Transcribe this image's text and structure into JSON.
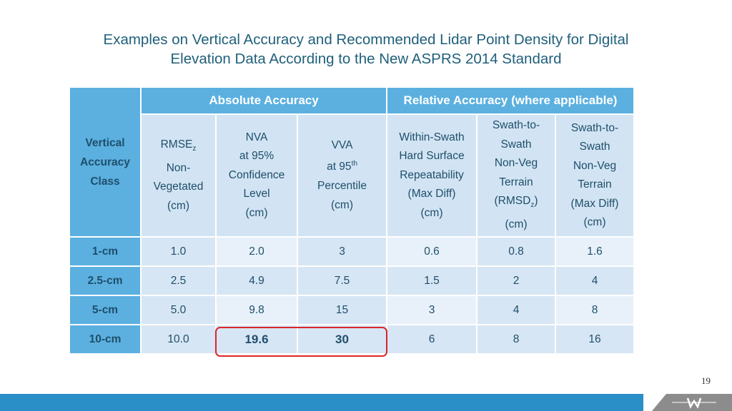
{
  "title": {
    "line1": "Examples on Vertical Accuracy and Recommended Lidar Point Density for Digital",
    "line2": "Elevation Data According to the New ASPRS 2014 Standard"
  },
  "table": {
    "group_headers": {
      "row_label": [
        "Vertical",
        "Accuracy",
        "Class"
      ],
      "absolute": "Absolute Accuracy",
      "relative": "Relative Accuracy (where applicable)"
    },
    "columns": [
      {
        "lines": [
          "RMSE",
          "Non-",
          "Vegetated",
          "(cm)"
        ],
        "first_sub": "z"
      },
      {
        "lines": [
          "NVA",
          "at 95%",
          "Confidence",
          "Level",
          "(cm)"
        ]
      },
      {
        "lines": [
          "VVA",
          "at 95",
          "Percentile",
          "(cm)"
        ],
        "second_sup": "th"
      },
      {
        "lines": [
          "Within-Swath",
          "Hard Surface",
          "Repeatability",
          "(Max Diff)",
          "(cm)"
        ]
      },
      {
        "lines": [
          "Swath-to-",
          "Swath",
          "Non-Veg",
          "Terrain",
          "(RMSD",
          "(cm)"
        ],
        "fifth_sub": "z",
        "fifth_suffix": ")"
      },
      {
        "lines": [
          "Swath-to-",
          "Swath",
          "Non-Veg",
          "Terrain",
          "(Max Diff)",
          "(cm)"
        ]
      }
    ],
    "rows": [
      {
        "class": "1-cm",
        "values": [
          "1.0",
          "2.0",
          "3",
          "0.6",
          "0.8",
          "1.6"
        ]
      },
      {
        "class": "2.5-cm",
        "values": [
          "2.5",
          "4.9",
          "7.5",
          "1.5",
          "2",
          "4"
        ]
      },
      {
        "class": "5-cm",
        "values": [
          "5.0",
          "9.8",
          "15",
          "3",
          "4",
          "8"
        ]
      },
      {
        "class": "10-cm",
        "values": [
          "10.0",
          "19.6",
          "30",
          "6",
          "8",
          "16"
        ]
      }
    ],
    "highlighted": {
      "row": "10-cm",
      "columns": [
        "NVA",
        "VVA"
      ],
      "color": "#d9262b"
    }
  },
  "page_number": "19",
  "colors": {
    "header_blue": "#5bb0e0",
    "footer_blue": "#2a8fc6",
    "footer_gray": "#8c8c8c",
    "title_color": "#1f5f7a"
  }
}
